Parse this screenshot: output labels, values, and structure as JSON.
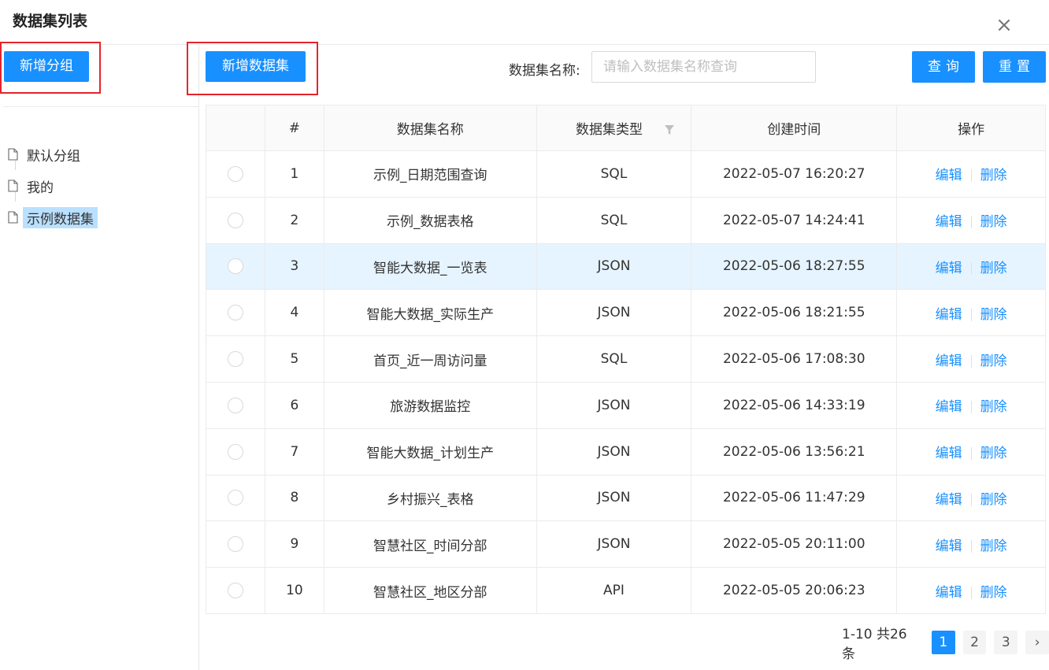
{
  "dialog": {
    "title": "数据集列表",
    "close": "×"
  },
  "sidebar": {
    "add_group_label": "新增分组",
    "groups": [
      {
        "label": "默认分组",
        "selected": false
      },
      {
        "label": "我的",
        "selected": false
      },
      {
        "label": "示例数据集",
        "selected": true
      }
    ]
  },
  "toolbar": {
    "add_dataset_label": "新增数据集",
    "search_label": "数据集名称:",
    "search_placeholder": "请输入数据集名称查询",
    "search_value": "",
    "query_label": "查询",
    "reset_label": "重置"
  },
  "table": {
    "columns": [
      "",
      "#",
      "数据集名称",
      "数据集类型",
      "创建时间",
      "操作"
    ],
    "edit_label": "编辑",
    "delete_label": "删除",
    "rows": [
      {
        "index": "1",
        "name": "示例_日期范围查询",
        "type": "SQL",
        "created": "2022-05-07 16:20:27"
      },
      {
        "index": "2",
        "name": "示例_数据表格",
        "type": "SQL",
        "created": "2022-05-07 14:24:41"
      },
      {
        "index": "3",
        "name": "智能大数据_一览表",
        "type": "JSON",
        "created": "2022-05-06 18:27:55"
      },
      {
        "index": "4",
        "name": "智能大数据_实际生产",
        "type": "JSON",
        "created": "2022-05-06 18:21:55"
      },
      {
        "index": "5",
        "name": "首页_近一周访问量",
        "type": "SQL",
        "created": "2022-05-06 17:08:30"
      },
      {
        "index": "6",
        "name": "旅游数据监控",
        "type": "JSON",
        "created": "2022-05-06 14:33:19"
      },
      {
        "index": "7",
        "name": "智能大数据_计划生产",
        "type": "JSON",
        "created": "2022-05-06 13:56:21"
      },
      {
        "index": "8",
        "name": "乡村振兴_表格",
        "type": "JSON",
        "created": "2022-05-06 11:47:29"
      },
      {
        "index": "9",
        "name": "智慧社区_时间分部",
        "type": "JSON",
        "created": "2022-05-05 20:11:00"
      },
      {
        "index": "10",
        "name": "智慧社区_地区分部",
        "type": "API",
        "created": "2022-05-05 20:06:23"
      }
    ]
  },
  "pagination": {
    "total_text": "1-10 共26条",
    "pages": [
      "1",
      "2",
      "3"
    ],
    "current": "1",
    "next": "›"
  },
  "colors": {
    "primary": "#1890ff",
    "highlight_row": "#e6f4ff",
    "annotation": "#e5242b",
    "selected_tree": "#bae0ff"
  },
  "icons": {
    "tree_item": "file-icon",
    "type_column": "filter-icon",
    "close": "close-icon"
  }
}
